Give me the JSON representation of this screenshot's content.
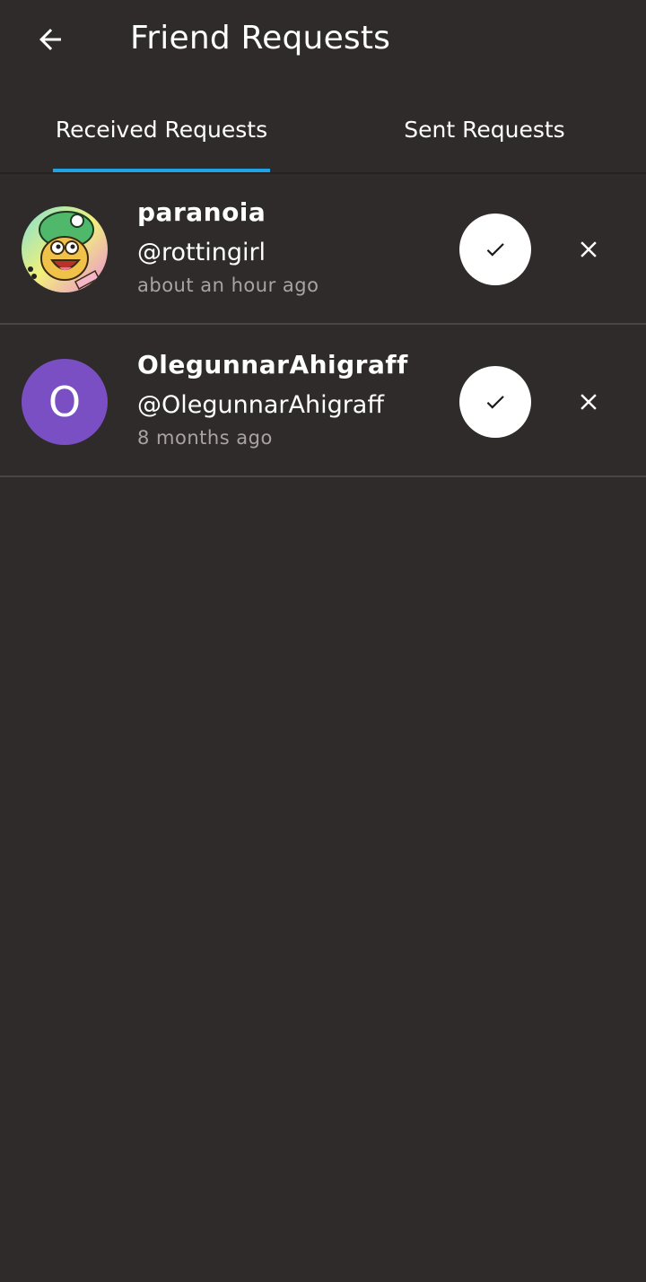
{
  "header": {
    "title": "Friend Requests",
    "back_icon": "arrow-left-icon"
  },
  "tabs": [
    {
      "label": "Received Requests",
      "active": true
    },
    {
      "label": "Sent Requests",
      "active": false
    }
  ],
  "colors": {
    "background": "#2f2b2a",
    "tab_indicator": "#1fa2e6",
    "initial_avatar": "#7a4fc4",
    "secondary_text": "#a9a4a2"
  },
  "requests": [
    {
      "display_name": "paranoia",
      "handle": "@rottingirl",
      "time": "about an hour ago",
      "avatar": "cartoon-character-avatar",
      "accept_icon": "checkmark-icon",
      "decline_icon": "close-icon"
    },
    {
      "display_name": "OlegunnarAhigraff",
      "handle": "@OlegunnarAhigraff",
      "time": "8 months ago",
      "avatar_initial": "O",
      "accept_icon": "checkmark-icon",
      "decline_icon": "close-icon"
    }
  ]
}
